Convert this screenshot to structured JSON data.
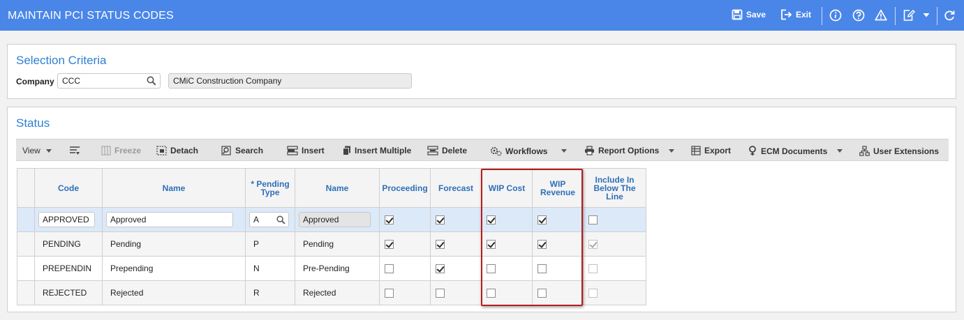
{
  "header": {
    "title": "MAINTAIN PCI STATUS CODES",
    "save_label": "Save",
    "exit_label": "Exit",
    "icons": [
      "save-icon",
      "exit-icon",
      "info-icon",
      "help-icon",
      "warning-icon",
      "edit-icon",
      "chevron-down-icon",
      "refresh-icon"
    ]
  },
  "selection": {
    "title": "Selection Criteria",
    "company_label": "Company",
    "company_code": "CCC",
    "company_name": "CMiC Construction Company"
  },
  "status": {
    "title": "Status",
    "toolbar": {
      "view": "View",
      "freeze": "Freeze",
      "detach": "Detach",
      "search": "Search",
      "insert": "Insert",
      "insert_multiple": "Insert Multiple",
      "delete": "Delete",
      "workflows": "Workflows",
      "report_options": "Report Options",
      "export": "Export",
      "ecm_documents": "ECM Documents",
      "user_extensions": "User Extensions"
    },
    "columns": {
      "code": "Code",
      "name": "Name",
      "pending_type_line1": "* Pending",
      "pending_type_line2": "Type",
      "type_name": "Name",
      "proceeding": "Proceeding",
      "forecast": "Forecast",
      "wip_cost": "WIP Cost",
      "wip_revenue_line1": "WIP",
      "wip_revenue_line2": "Revenue",
      "include_line1": "Include In",
      "include_line2": "Below The",
      "include_line3": "Line"
    },
    "rows": [
      {
        "code": "APPROVED",
        "name": "Approved",
        "pending_type": "A",
        "type_name": "Approved",
        "proceeding": true,
        "forecast": true,
        "wip_cost": true,
        "wip_revenue": true,
        "include_below_line": false
      },
      {
        "code": "PENDING",
        "name": "Pending",
        "pending_type": "P",
        "type_name": "Pending",
        "proceeding": true,
        "forecast": true,
        "wip_cost": true,
        "wip_revenue": true,
        "include_below_line": true
      },
      {
        "code": "PREPENDIN",
        "name": "Prepending",
        "pending_type": "N",
        "type_name": "Pre-Pending",
        "proceeding": false,
        "forecast": true,
        "wip_cost": false,
        "wip_revenue": false,
        "include_below_line": false
      },
      {
        "code": "REJECTED",
        "name": "Rejected",
        "pending_type": "R",
        "type_name": "Rejected",
        "proceeding": false,
        "forecast": false,
        "wip_cost": false,
        "wip_revenue": false,
        "include_below_line": false
      }
    ]
  },
  "colors": {
    "header_bg": "#4a86e8",
    "section_title": "#2f7fd1",
    "column_header": "#2f6fb8",
    "selected_row": "#dce9f8",
    "highlight_box": "#b81c1c"
  }
}
